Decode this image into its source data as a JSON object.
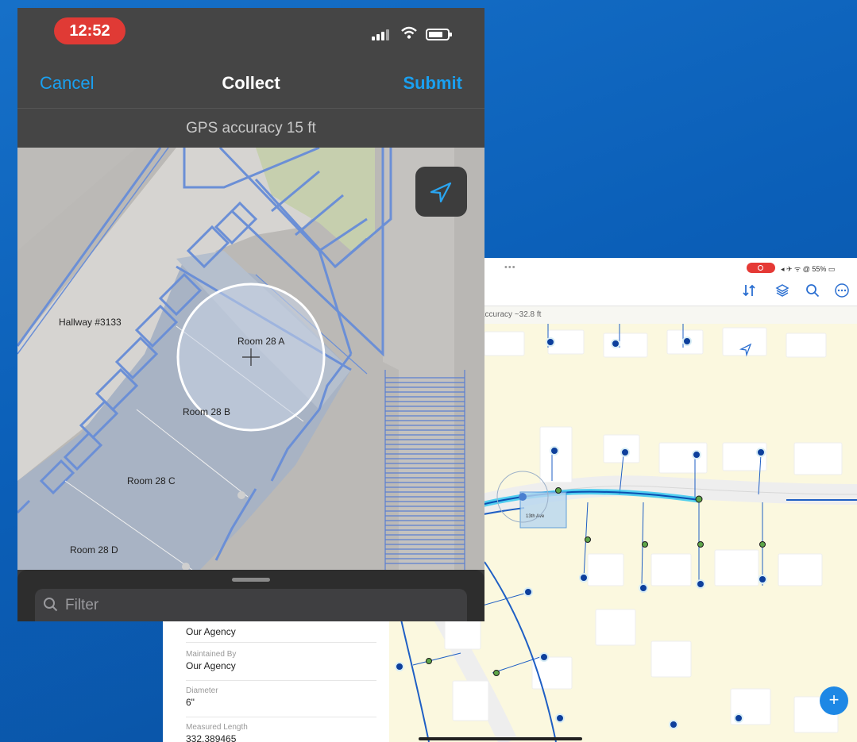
{
  "phone": {
    "status": {
      "time": "12:52"
    },
    "nav": {
      "cancel": "Cancel",
      "title": "Collect",
      "submit": "Submit"
    },
    "gps_accuracy": "GPS accuracy 15 ft",
    "map_labels": {
      "hallway": "Hallway #3133",
      "room_a": "Room 28 A",
      "room_b": "Room 28 B",
      "room_c": "Room 28 C",
      "room_d": "Room 28 D"
    },
    "filter_placeholder": "Filter"
  },
  "tablet": {
    "status_text": "◂ ✈ ᯤ @ 55% ▭",
    "dots": "•••",
    "accuracy": "accuracy ~32.8 ft",
    "street_label": "13th Ave",
    "toolbar_icons": [
      "sort-icon",
      "layers-icon",
      "search-icon",
      "more-icon"
    ],
    "fields": [
      {
        "label": "",
        "value": "Our Agency"
      },
      {
        "label": "Maintained By",
        "value": "Our Agency"
      },
      {
        "label": "Diameter",
        "value": "6\""
      },
      {
        "label": "Measured Length",
        "value": "332.389465"
      }
    ]
  },
  "colors": {
    "link_blue": "#1aa0f0",
    "status_red": "#e03a35",
    "floorplan_line": "#6b8fd6",
    "pipe_highlight": "#29c6f0",
    "add_button": "#1e88e5"
  }
}
